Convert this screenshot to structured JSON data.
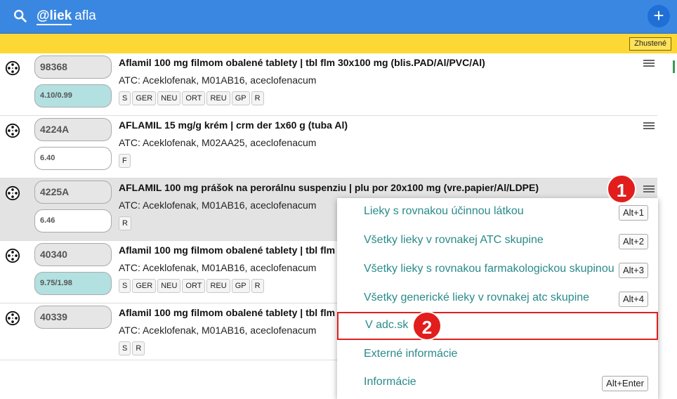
{
  "header": {
    "query_prefix": "@liek",
    "query_term": "afla",
    "add_label": "+"
  },
  "toolbar": {
    "mode_label": "Zhustené"
  },
  "rows": [
    {
      "code": "98368",
      "price": "4.10/0.99",
      "title": "Aflamil 100 mg filmom obalené tablety | tbl flm 30x100 mg (blis.PAD/Al/PVC/Al)",
      "atc": "ATC: Aceklofenak, M01AB16, aceclofenacum",
      "tags": [
        "S",
        "GER",
        "NEU",
        "ORT",
        "REU",
        "GP",
        "R"
      ]
    },
    {
      "code": "4224A",
      "price": "6.40",
      "title": "AFLAMIL 15 mg/g krém | crm der 1x60 g (tuba Al)",
      "atc": "ATC: Aceklofenak, M02AA25, aceclofenacum",
      "tags": [
        "F"
      ]
    },
    {
      "code": "4225A",
      "price": "6.46",
      "title": "AFLAMIL 100 mg prášok na perorálnu suspenziu | plu por 20x100 mg (vre.papier/Al/LDPE)",
      "atc": "ATC: Aceklofenak, M01AB16, aceclofenacum",
      "tags": [
        "R"
      ]
    },
    {
      "code": "40340",
      "price": "9.75/1.98",
      "title": "Aflamil 100 mg filmom obalené tablety | tbl flm",
      "atc": "ATC: Aceklofenak, M01AB16, aceclofenacum",
      "tags": [
        "S",
        "GER",
        "NEU",
        "ORT",
        "REU",
        "GP",
        "R"
      ]
    },
    {
      "code": "40339",
      "price": "",
      "title": "Aflamil 100 mg filmom obalené tablety | tbl flm",
      "atc": "ATC: Aceklofenak, M01AB16, aceclofenacum",
      "tags": [
        "S",
        "R"
      ]
    }
  ],
  "context_menu": [
    {
      "label": "Lieky s rovnakou účinnou látkou",
      "shortcut": "Alt+1"
    },
    {
      "label": "Všetky lieky v rovnakej ATC skupine",
      "shortcut": "Alt+2"
    },
    {
      "label": "Všetky lieky s rovnakou farmakologickou skupinou",
      "shortcut": "Alt+3"
    },
    {
      "label": "Všetky generické lieky v rovnakej atc skupine",
      "shortcut": "Alt+4"
    },
    {
      "label": "V adc.sk",
      "shortcut": ""
    },
    {
      "label": "Externé informácie",
      "shortcut": ""
    },
    {
      "label": "Informácie",
      "shortcut": "Alt+Enter"
    }
  ],
  "callouts": [
    "1",
    "2"
  ],
  "colors": {
    "header_blue": "#3a87e1",
    "yellow_bar": "#fdd835",
    "menu_text": "#2a8a8a",
    "callout_red": "#e21d1d",
    "price_teal": "#b3e0e0"
  }
}
